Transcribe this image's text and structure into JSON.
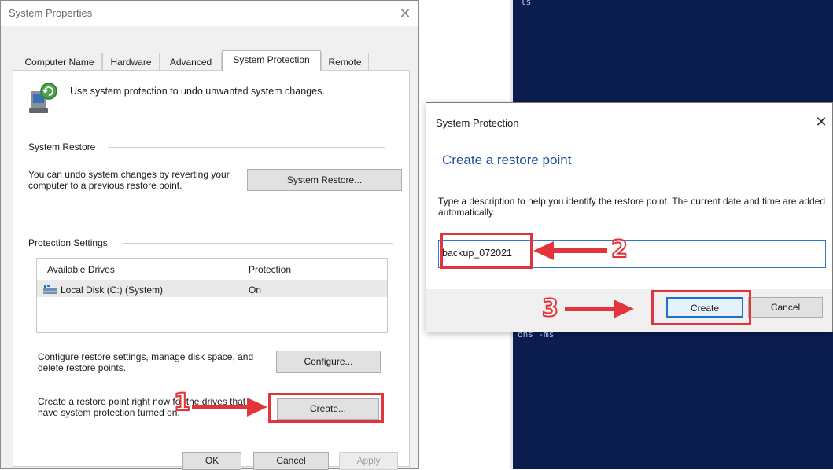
{
  "background": {
    "terminal_text_top": "ls",
    "terminal_text_mid": "ons -ms"
  },
  "system_properties": {
    "title": "System Properties",
    "tabs": [
      {
        "label": "Computer Name"
      },
      {
        "label": "Hardware"
      },
      {
        "label": "Advanced"
      },
      {
        "label": "System Protection",
        "active": true
      },
      {
        "label": "Remote"
      }
    ],
    "intro_text": "Use system protection to undo unwanted system changes.",
    "system_restore": {
      "group_label": "System Restore",
      "description": "You can undo system changes by reverting your computer to a previous restore point.",
      "button_label": "System Restore..."
    },
    "protection_settings": {
      "group_label": "Protection Settings",
      "columns": [
        "Available Drives",
        "Protection"
      ],
      "rows": [
        {
          "drive": "Local Disk (C:) (System)",
          "protection": "On"
        }
      ],
      "configure_text": "Configure restore settings, manage disk space, and delete restore points.",
      "configure_button": "Configure...",
      "create_text": "Create a restore point right now for the drives that have system protection turned on.",
      "create_button": "Create..."
    },
    "footer": {
      "ok": "OK",
      "cancel": "Cancel",
      "apply": "Apply"
    }
  },
  "create_dialog": {
    "title": "System Protection",
    "heading": "Create a restore point",
    "description": "Type a description to help you identify the restore point. The current date and time are added automatically.",
    "input_value": "backup_072021",
    "create_button": "Create",
    "cancel_button": "Cancel"
  },
  "annotations": {
    "step1": "1",
    "step2": "2",
    "step3": "3",
    "color": "#e2353b"
  }
}
